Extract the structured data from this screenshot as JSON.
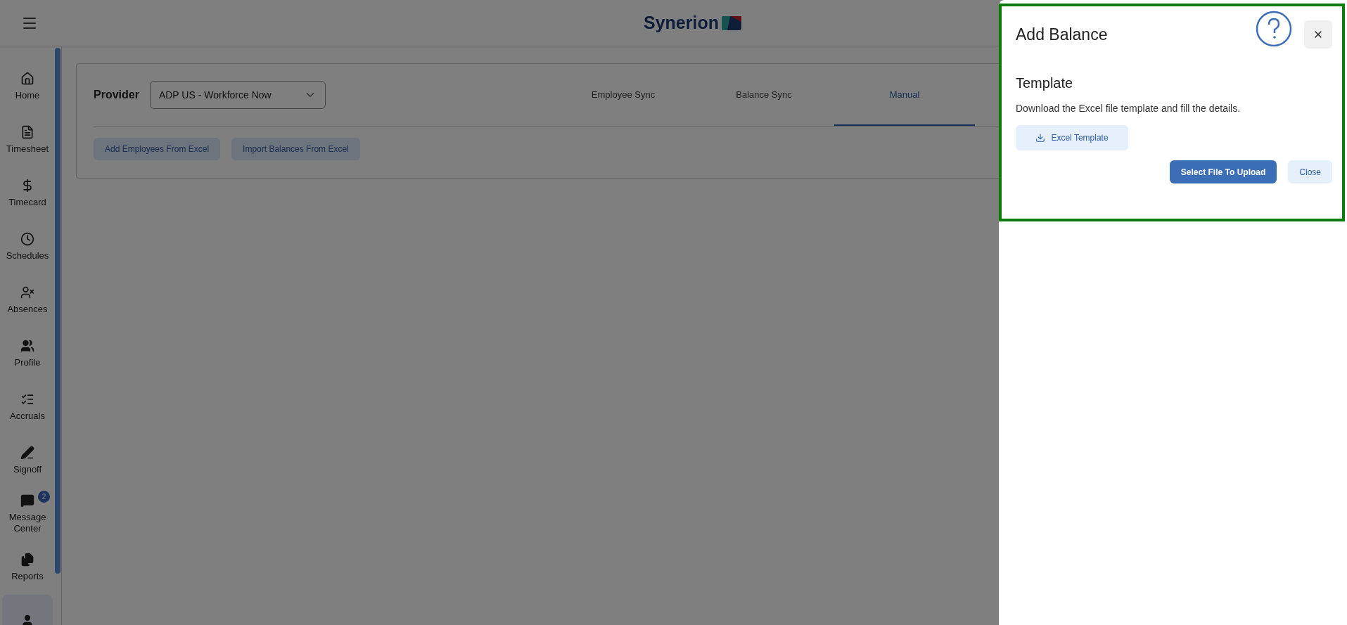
{
  "header": {
    "logo_text": "Synerion"
  },
  "sidebar": {
    "items": [
      {
        "label": "Home",
        "selected": false
      },
      {
        "label": "Timesheet",
        "selected": false
      },
      {
        "label": "Timecard",
        "selected": false
      },
      {
        "label": "Schedules",
        "selected": false
      },
      {
        "label": "Absences",
        "selected": false
      },
      {
        "label": "Profile",
        "selected": false
      },
      {
        "label": "Accruals",
        "selected": false
      },
      {
        "label": "Signoff",
        "selected": false
      },
      {
        "label": "Message Center",
        "selected": false,
        "badge": "2"
      },
      {
        "label": "Reports",
        "selected": false
      },
      {
        "selected": true
      }
    ]
  },
  "provider": {
    "label": "Provider",
    "value": "ADP US - Workforce Now"
  },
  "tabs": [
    {
      "label": "Employee Sync",
      "selected": false
    },
    {
      "label": "Balance Sync",
      "selected": false
    },
    {
      "label": "Manual",
      "selected": true
    }
  ],
  "actions": [
    "Add Employees From Excel",
    "Import Balances From Excel"
  ],
  "drawer": {
    "title": "Add Balance",
    "section_title": "Template",
    "description": "Download the Excel file template and fill the details.",
    "template_button": "Excel Template",
    "upload_button": "Select File To Upload",
    "close_button": "Close"
  }
}
